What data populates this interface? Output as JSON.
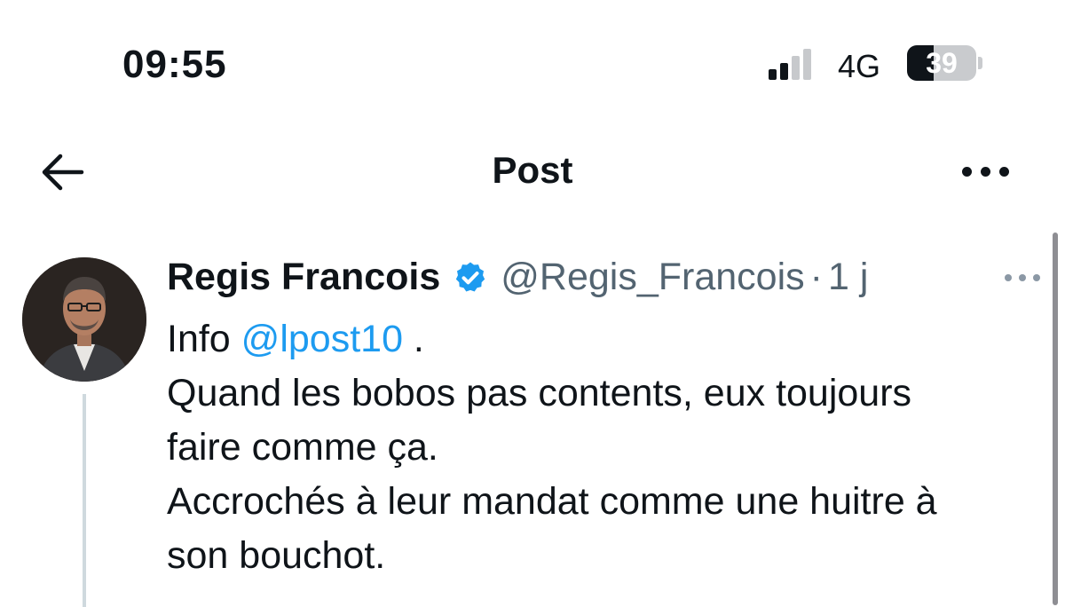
{
  "status_bar": {
    "time": "09:55",
    "network": "4G",
    "battery": "39",
    "battery_level": 0.39,
    "signal_bars_active": 2
  },
  "header": {
    "title": "Post",
    "back_icon": "arrow-left-icon",
    "more_icon": "more-horizontal-icon"
  },
  "tweet": {
    "author_name": "Regis Francois",
    "handle": "@Regis_Francois",
    "separator": "·",
    "age": "1 j",
    "verified_icon": "verified-badge-icon",
    "text": {
      "line1_prefix": "Info ",
      "mention": "@lpost10",
      "line1_suffix": " .",
      "line2": "Quand les bobos pas contents, eux toujours",
      "line3": "faire comme ça.",
      "line4": "Accrochés à leur mandat comme une huitre à",
      "line5": "son bouchot."
    }
  },
  "colors": {
    "text": "#0f1419",
    "secondary": "#536471",
    "accent": "#1d9bf0"
  }
}
